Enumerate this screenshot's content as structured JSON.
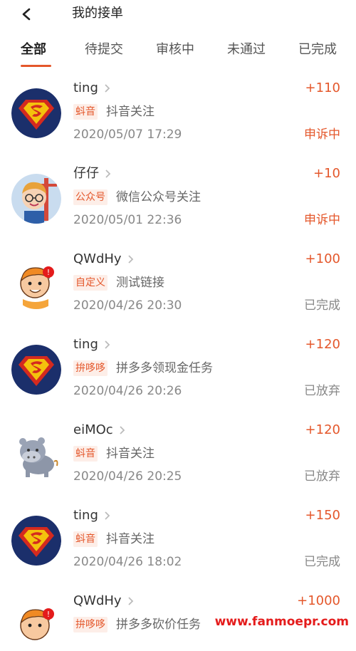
{
  "header": {
    "title": "我的接单"
  },
  "tabs": [
    {
      "label": "全部",
      "active": true
    },
    {
      "label": "待提交",
      "active": false
    },
    {
      "label": "审核中",
      "active": false
    },
    {
      "label": "未通过",
      "active": false
    },
    {
      "label": "已完成",
      "active": false
    }
  ],
  "orders": [
    {
      "name": "ting",
      "amount": "+110",
      "badge": "蚪音",
      "desc": "抖音关注",
      "time": "2020/05/07 17:29",
      "status": "申诉中",
      "avatar": "superman-avatar"
    },
    {
      "name": "仔仔",
      "amount": "+10",
      "badge": "公众号",
      "desc": "微信公众号关注",
      "time": "2020/05/01 22:36",
      "status": "申诉中",
      "avatar": "boy-avatar"
    },
    {
      "name": "QWdHy",
      "amount": "+100",
      "badge": "自定义",
      "desc": "测试链接",
      "time": "2020/04/26 20:30",
      "status": "已完成",
      "avatar": "cartoon-avatar"
    },
    {
      "name": "ting",
      "amount": "+120",
      "badge": "拚哆哆",
      "desc": "拼多多领现金任务",
      "time": "2020/04/26 20:26",
      "status": "已放弃",
      "avatar": "superman-avatar"
    },
    {
      "name": "eiMOc",
      "amount": "+120",
      "badge": "蚪音",
      "desc": "抖音关注",
      "time": "2020/04/26 20:25",
      "status": "已放弃",
      "avatar": "hippo-avatar"
    },
    {
      "name": "ting",
      "amount": "+150",
      "badge": "蚪音",
      "desc": "抖音关注",
      "time": "2020/04/26 18:02",
      "status": "已完成",
      "avatar": "superman-avatar"
    },
    {
      "name": "QWdHy",
      "amount": "+1000",
      "badge": "拚哆哆",
      "desc": "拼多多砍价任务",
      "time": "",
      "status": "",
      "avatar": "cartoon-avatar"
    }
  ],
  "watermark": "www.fanmoepr.com",
  "colors": {
    "accent": "#e4572b",
    "muted": "#888888"
  }
}
